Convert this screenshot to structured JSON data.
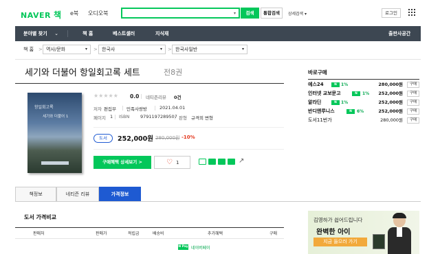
{
  "header": {
    "logo_naver": "NAVER",
    "logo_book": "책",
    "links": [
      "e북",
      "오디오북"
    ],
    "search_value": "",
    "search_button": "검색",
    "unified_search": "통합검색",
    "detail_search": "상세검색 ▾",
    "login": "로그인"
  },
  "nav": {
    "items": [
      "분야별 찾기",
      "책 홈",
      "베스트셀러",
      "지식재"
    ],
    "right": "출판사공간"
  },
  "breadcrumb": {
    "home": "책 홈",
    "sep": ">",
    "levels": [
      "역사/문화",
      "한국사",
      "한국사일반"
    ]
  },
  "book": {
    "title": "세기와 더불어 항일회고록 세트",
    "volumes": "전8권",
    "cover_title": "세기와 더불어 1",
    "cover_subtitle": "항일회고록",
    "rating_score": "0.0",
    "review_label": "네티즌리뷰",
    "review_count": "0건",
    "author_label": "저자",
    "author": "편집부",
    "publisher": "민족사랑방",
    "date": "2021.04.01",
    "pages_label": "페이지",
    "pages": "1",
    "isbn_label": "ISBN",
    "isbn": "9791197289507",
    "edition_label": "판형",
    "edition": "규격외 변형",
    "format_badge": "도서",
    "price": "252,000원",
    "original_price": "280,000원",
    "discount": "-10%",
    "buy_button": "구매혜택 상세보기 >",
    "like_count": "1"
  },
  "purchase": {
    "title": "바로구매",
    "buy_label": "구매",
    "stores": [
      {
        "name": "예스24",
        "npay": "N Pay",
        "pct": "1%",
        "price": "280,000원"
      },
      {
        "name": "인터넷 교보문고",
        "npay": "N Pay",
        "pct": "1%",
        "price": "252,000원"
      },
      {
        "name": "알라딘",
        "npay": "N Pay",
        "pct": "1%",
        "price": "252,000원"
      },
      {
        "name": "반디앤루니스",
        "npay": "N Pay",
        "pct": "6%",
        "price": "252,000원"
      },
      {
        "name": "도서11번가",
        "npay": "",
        "pct": "",
        "price": "280,000원"
      }
    ]
  },
  "tabs": [
    "책정보",
    "네티즌 리뷰",
    "가격정보"
  ],
  "active_tab": "가격정보",
  "price_compare": {
    "title": "도서 가격비교",
    "columns": [
      "판매처",
      "판매가",
      "적립금",
      "배송비",
      "추가혜택",
      "구매"
    ],
    "npay": "N Pay",
    "benefit": "네이버페이"
  },
  "ad": {
    "line1": "김영하가 쉽어드립니다",
    "line2": "완벽한 아이",
    "cta": "지금 들으러 가기"
  },
  "colors": {
    "brand_green": "#03c75a",
    "nav_bg": "#3d4752",
    "tab_active": "#1e5ad2",
    "discount_red": "#e4371d"
  }
}
